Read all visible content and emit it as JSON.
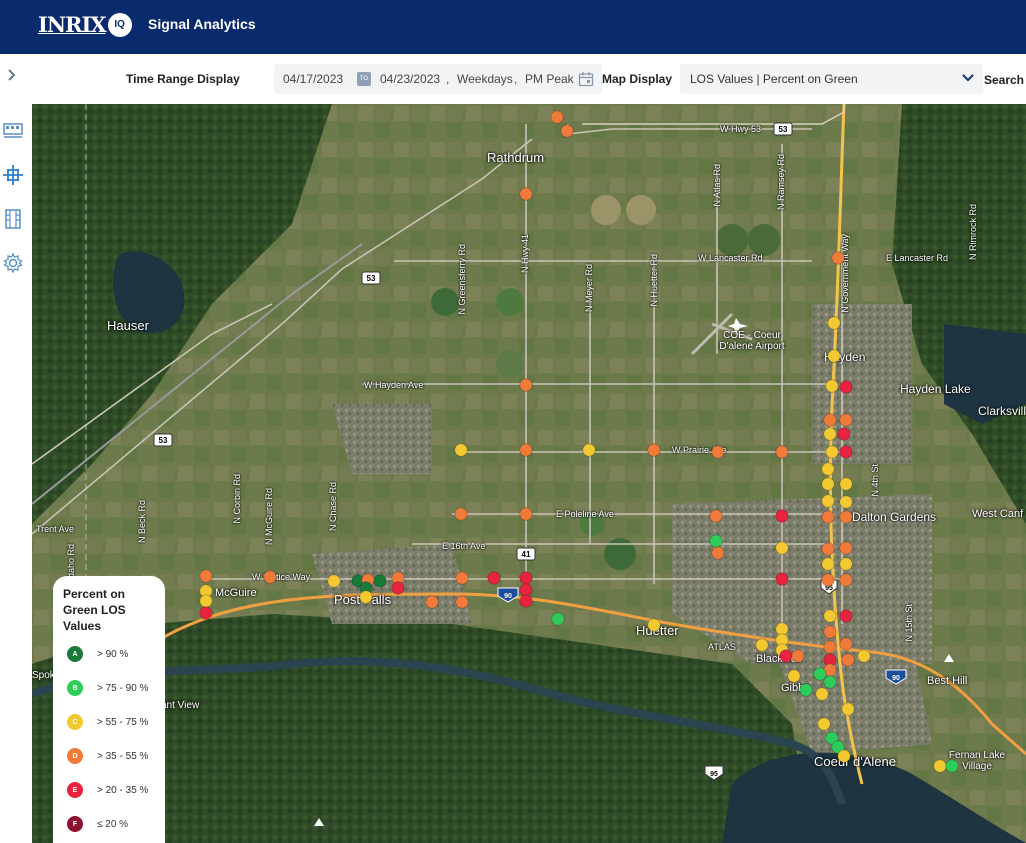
{
  "header": {
    "logo": "INRIX",
    "logo_badge": "IQ",
    "title": "Signal Analytics"
  },
  "sidebar": {
    "icons": [
      "dashboard-icon",
      "signal-network-icon",
      "report-icon",
      "settings-icon"
    ]
  },
  "filters": {
    "time_range_label": "Time Range Display",
    "start_date": "04/17/2023",
    "to_badge": "TO",
    "end_date": "04/23/2023",
    "days": "Weekdays",
    "period": "PM Peak",
    "map_display_label": "Map Display",
    "map_display_value": "LOS Values | Percent on Green",
    "search_label": "Search"
  },
  "map": {
    "places": [
      "Rathdrum",
      "Hauser",
      "Hayden",
      "Hayden Lake",
      "Clarksvill",
      "Dalton Gardens",
      "West Canf",
      "McGuire",
      "Post Falls",
      "Huetter",
      "Blackwell",
      "Gibbs",
      "Best Hill",
      "Coeur d'Alene",
      "Fernan Lake Village",
      "COE - Coeur D'alene Airport",
      "sant View",
      "Spok"
    ],
    "roads": [
      "W Hwy 53",
      "W Lancaster Rd",
      "E Lancaster Rd",
      "W Hayden Ave",
      "W Prairie Ave",
      "E Poleline Ave",
      "E 16th Ave",
      "W Seltice Way",
      "Trent Ave",
      "N Hwy 41",
      "N Meyer Rd",
      "N Huetter Rd",
      "N Atlas Rd",
      "N Ramsey Rd",
      "N Greensferry Rd",
      "N Government Way",
      "N 4th St",
      "N 15th St",
      "N Rimrock Rd",
      "N Corbin Rd",
      "N McGuire Rd",
      "N Chase Rd",
      "N Beck Rd",
      "N Idaho Rd",
      "ATLAS"
    ],
    "shields": [
      "53",
      "53",
      "53",
      "41",
      "90",
      "95",
      "95",
      "90",
      "95"
    ]
  },
  "legend": {
    "title": "Percent on Green LOS Values",
    "items": [
      {
        "grade": "A",
        "label": "> 90 %",
        "color": "#1a7a3a"
      },
      {
        "grade": "B",
        "label": "> 75 - 90 %",
        "color": "#2ecc5a"
      },
      {
        "grade": "C",
        "label": "> 55 - 75 %",
        "color": "#f2c930"
      },
      {
        "grade": "D",
        "label": "> 35 - 55 %",
        "color": "#f07a3a"
      },
      {
        "grade": "E",
        "label": "> 20 - 35 %",
        "color": "#e8233f"
      },
      {
        "grade": "F",
        "label": "≤ 20 %",
        "color": "#8e1230"
      }
    ]
  }
}
